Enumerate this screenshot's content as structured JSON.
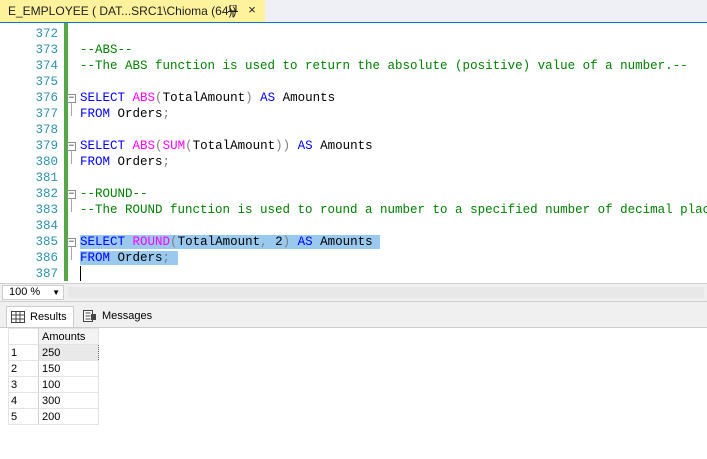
{
  "tab": {
    "title": "E_EMPLOYEE ( DAT...SRC1\\Chioma (64))",
    "pin_icon": "pin-icon",
    "close_icon": "×"
  },
  "editor": {
    "lines": [
      {
        "num": "372",
        "text": ""
      },
      {
        "num": "373",
        "text": "--ABS--"
      },
      {
        "num": "374",
        "text": "--The ABS function is used to return the absolute (positive) value of a number.--"
      },
      {
        "num": "375",
        "text": ""
      },
      {
        "num": "376",
        "text": "SELECT ABS(TotalAmount) AS Amounts"
      },
      {
        "num": "377",
        "text": "FROM Orders;"
      },
      {
        "num": "378",
        "text": ""
      },
      {
        "num": "379",
        "text": "SELECT ABS(SUM(TotalAmount)) AS Amounts"
      },
      {
        "num": "380",
        "text": "FROM Orders;"
      },
      {
        "num": "381",
        "text": ""
      },
      {
        "num": "382",
        "text": "--ROUND--"
      },
      {
        "num": "383",
        "text": "--The ROUND function is used to round a number to a specified number of decimal places--"
      },
      {
        "num": "384",
        "text": ""
      },
      {
        "num": "385",
        "text": "SELECT ROUND(TotalAmount, 2) AS Amounts"
      },
      {
        "num": "386",
        "text": "FROM Orders;"
      },
      {
        "num": "387",
        "text": ""
      }
    ]
  },
  "zoom": {
    "value": "100 %"
  },
  "results_tabs": [
    {
      "label": "Results",
      "icon": "grid-icon"
    },
    {
      "label": "Messages",
      "icon": "messages-icon"
    }
  ],
  "results": {
    "columns": [
      "Amounts"
    ],
    "rows": [
      {
        "num": "1",
        "value": "250"
      },
      {
        "num": "2",
        "value": "150"
      },
      {
        "num": "3",
        "value": "100"
      },
      {
        "num": "4",
        "value": "300"
      },
      {
        "num": "5",
        "value": "200"
      }
    ]
  },
  "colors": {
    "tab_active": "#fff29d",
    "keyword": "#0000ff",
    "function": "#ff00ff",
    "comment": "#008000",
    "selection": "#99c9ef",
    "line_number": "#2b91af"
  }
}
